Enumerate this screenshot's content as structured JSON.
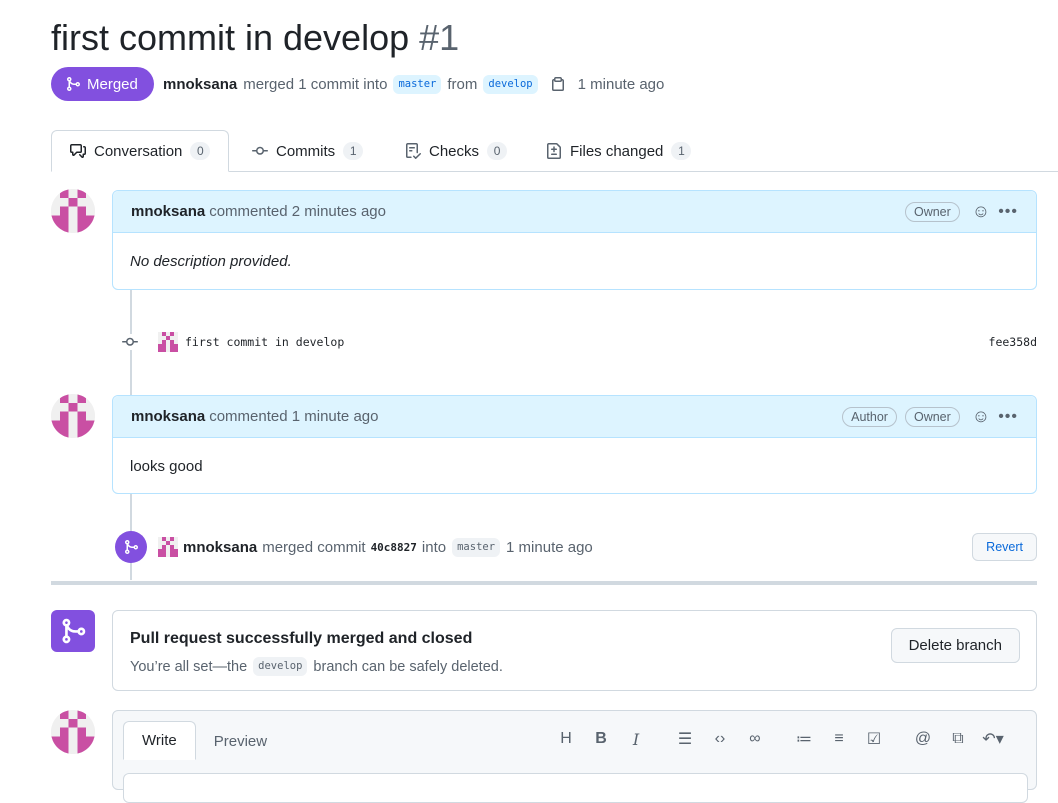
{
  "pr": {
    "title": "first commit in develop",
    "number": "#1",
    "state": "Merged",
    "author": "mnoksana",
    "merge_text": "merged 1 commit into",
    "base_branch": "master",
    "from_text": "from",
    "head_branch": "develop",
    "time": "1 minute ago"
  },
  "tabs": [
    {
      "label": "Conversation",
      "count": "0",
      "icon": "comment-discussion-icon"
    },
    {
      "label": "Commits",
      "count": "1",
      "icon": "git-commit-icon"
    },
    {
      "label": "Checks",
      "count": "0",
      "icon": "checklist-icon"
    },
    {
      "label": "Files changed",
      "count": "1",
      "icon": "file-diff-icon"
    }
  ],
  "comments": [
    {
      "author": "mnoksana",
      "action": "commented 2 minutes ago",
      "labels": [
        "Owner"
      ],
      "body": "No description provided."
    },
    {
      "author": "mnoksana",
      "action": "commented 1 minute ago",
      "labels": [
        "Author",
        "Owner"
      ],
      "body": "looks good"
    }
  ],
  "commit": {
    "message": "first commit in develop",
    "sha": "fee358d"
  },
  "merge_event": {
    "author": "mnoksana",
    "text1": "merged commit",
    "sha": "40c8827",
    "text2": "into",
    "branch": "master",
    "time": "1 minute ago",
    "revert_label": "Revert"
  },
  "merged_box": {
    "title": "Pull request successfully merged and closed",
    "text_before": "You’re all set—the",
    "branch": "develop",
    "text_after": "branch can be safely deleted.",
    "delete_label": "Delete branch"
  },
  "editor": {
    "write_tab": "Write",
    "preview_tab": "Preview",
    "toolbar": [
      "heading-icon",
      "bold-icon",
      "italic-icon",
      "quote-icon",
      "code-icon",
      "link-icon",
      "unordered-list-icon",
      "ordered-list-icon",
      "tasklist-icon",
      "mention-icon",
      "cross-reference-icon",
      "reply-icon"
    ]
  },
  "colors": {
    "merged_purple": "#8250df",
    "link_blue": "#0969da",
    "comment_header": "#ddf4ff"
  }
}
